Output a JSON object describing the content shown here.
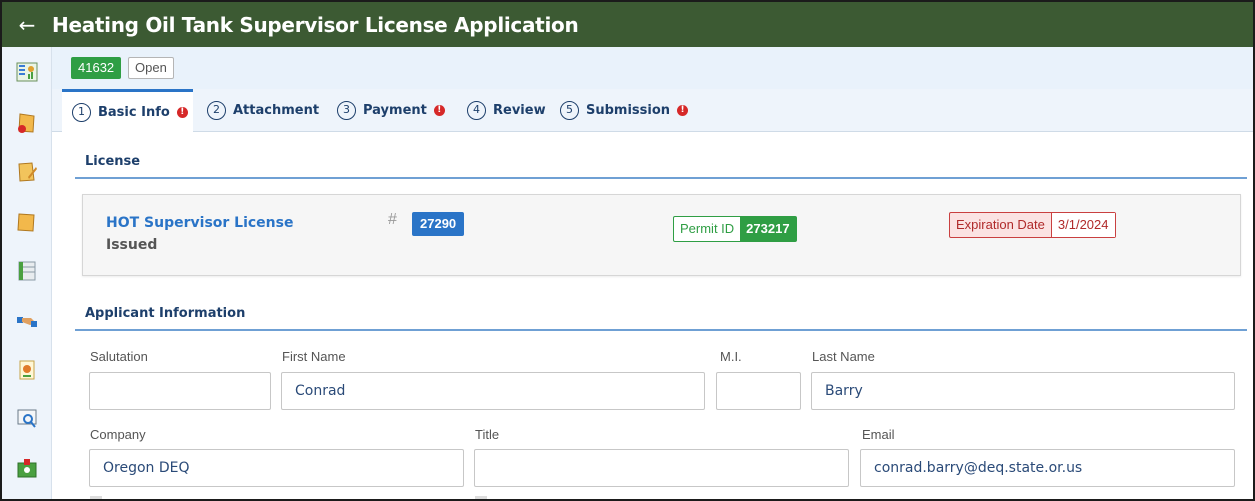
{
  "header": {
    "back_icon": "arrow-left-icon",
    "title": "Heating Oil Tank Supervisor License Application"
  },
  "sidebar": {
    "icons": [
      "dashboard-icon",
      "new-application-icon",
      "edit-document-icon",
      "folder-icon",
      "table-icon",
      "handshake-icon",
      "certificate-icon",
      "search-report-icon",
      "id-card-icon"
    ]
  },
  "status": {
    "record_id": "41632",
    "state": "Open"
  },
  "tabs": [
    {
      "number": "1",
      "label": "Basic Info",
      "alert": true
    },
    {
      "number": "2",
      "label": "Attachment",
      "alert": false
    },
    {
      "number": "3",
      "label": "Payment",
      "alert": true
    },
    {
      "number": "4",
      "label": "Review",
      "alert": false
    },
    {
      "number": "5",
      "label": "Submission",
      "alert": true
    }
  ],
  "license": {
    "section_title": "License",
    "name": "HOT Supervisor License",
    "status": "Issued",
    "hash_symbol": "#",
    "number": "27290",
    "permit_label": "Permit ID",
    "permit_id": "273217",
    "expiration_label": "Expiration Date",
    "expiration_date": "3/1/2024"
  },
  "applicant": {
    "section_title": "Applicant Information",
    "salutation_label": "Salutation",
    "salutation_value": "",
    "first_name_label": "First Name",
    "first_name_value": "Conrad",
    "mi_label": "M.I.",
    "mi_value": "",
    "last_name_label": "Last Name",
    "last_name_value": "Barry",
    "company_label": "Company",
    "company_value": "Oregon DEQ",
    "title_label": "Title",
    "title_value": "",
    "email_label": "Email",
    "email_value": "conrad.barry@deq.state.or.us"
  },
  "colors": {
    "header_bg": "#3c5a33",
    "accent_blue": "#2a74c7",
    "success_green": "#2f9e44",
    "danger_red": "#c94040"
  }
}
